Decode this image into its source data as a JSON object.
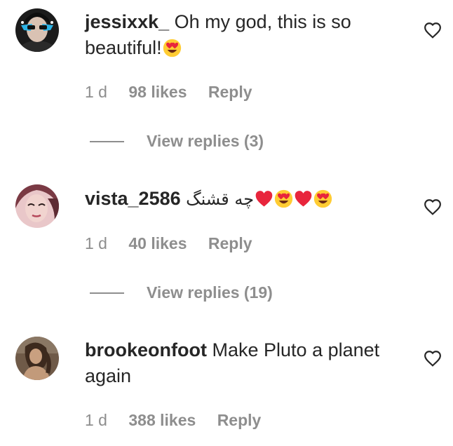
{
  "comments": [
    {
      "username": "jessixxk_",
      "text": "Oh my god, this is so beautiful!",
      "emojis": [
        "heart-eyes-emoji"
      ],
      "time": "1 d",
      "likes": "98 likes",
      "reply": "Reply",
      "view_replies": "View replies (3)"
    },
    {
      "username": "vista_2586",
      "text": "چه قشنگ",
      "emojis": [
        "red-heart-emoji",
        "heart-eyes-emoji",
        "red-heart-emoji",
        "heart-eyes-emoji"
      ],
      "time": "1 d",
      "likes": "40 likes",
      "reply": "Reply",
      "view_replies": "View replies (19)"
    },
    {
      "username": "brookeonfoot",
      "text": "Make Pluto a planet again",
      "emojis": [],
      "time": "1 d",
      "likes": "388 likes",
      "reply": "Reply"
    }
  ],
  "icons": {
    "like": "heart-outline-icon"
  },
  "colors": {
    "text": "#262626",
    "secondary": "#8e8e8e",
    "background": "#ffffff"
  }
}
